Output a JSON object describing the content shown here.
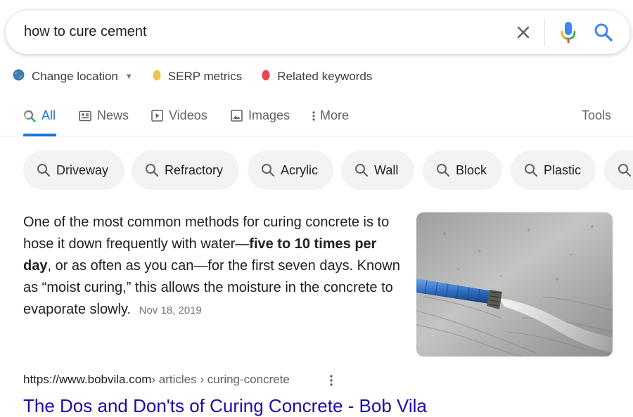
{
  "search": {
    "query": "how to cure cement"
  },
  "extensions": [
    {
      "label": "Change location",
      "icon": "globe-icon"
    },
    {
      "label": "SERP metrics",
      "icon": "yellow-dot-icon",
      "color": "#e7c84a"
    },
    {
      "label": "Related keywords",
      "icon": "red-dot-icon",
      "color": "#e5484d"
    }
  ],
  "tabs": {
    "all": "All",
    "news": "News",
    "videos": "Videos",
    "images": "Images",
    "more": "More",
    "tools": "Tools"
  },
  "chips": [
    "Driveway",
    "Refractory",
    "Acrylic",
    "Wall",
    "Block",
    "Plastic"
  ],
  "snippet": {
    "text_before": "One of the most common methods for curing concrete is to hose it down frequently with water—",
    "bold": "five to 10 times per day",
    "text_after": ", or as often as you can—for the first seven days. Known as “moist curing,” this allows the moisture in the concrete to evaporate slowly.",
    "date": "Nov 18, 2019"
  },
  "result": {
    "url_domain": "https://www.bobvila.com",
    "url_crumbs": " › articles › curing-concrete",
    "title": "The Dos and Don'ts of Curing Concrete - Bob Vila"
  },
  "colors": {
    "accent": "#1a73e8",
    "link": "#1a0dab",
    "chip_bg": "#f1f3f4"
  }
}
